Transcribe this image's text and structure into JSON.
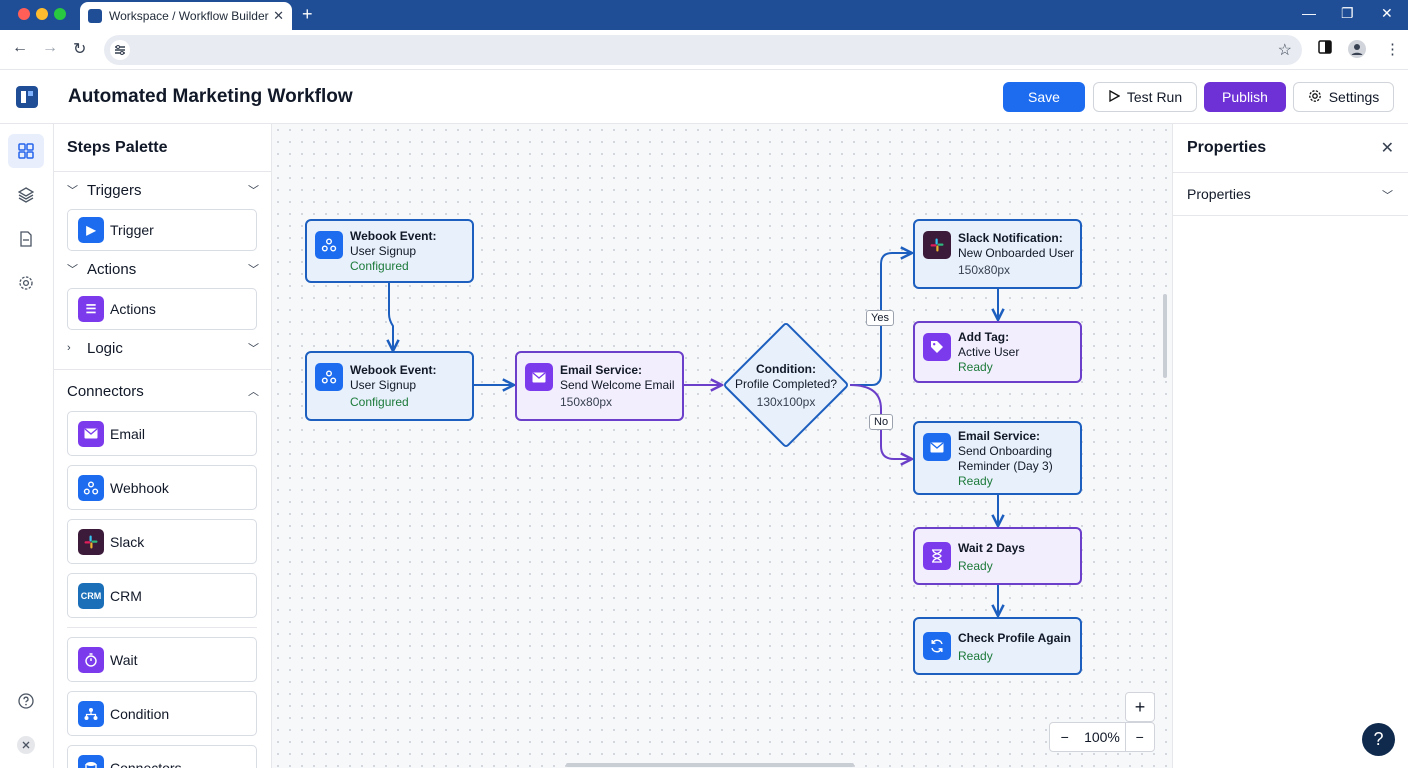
{
  "browser": {
    "tab_title": "Workspace / Workflow Builder",
    "tab_close": "✕",
    "new_tab": "+",
    "window_controls": [
      "—",
      "❐",
      "✕"
    ],
    "nav": {
      "back": "←",
      "forward": "→",
      "reload": "↻"
    },
    "site_info_icon": "tune-icon",
    "bookmark_icon": "star-icon"
  },
  "header": {
    "title": "Automated Marketing Workflow",
    "save": "Save",
    "test_run": "Test Run",
    "publish": "Publish",
    "settings": "Settings"
  },
  "palette": {
    "title": "Steps Palette",
    "sections": {
      "triggers": "Triggers",
      "actions": "Actions",
      "logic": "Logic",
      "connectors": "Connectors"
    },
    "items": {
      "trigger": "Trigger",
      "actions": "Actions",
      "email": "Email",
      "webhook": "Webhook",
      "slack": "Slack",
      "crm": "CRM",
      "crm_badge": "CRM",
      "wait": "Wait",
      "condition": "Condition",
      "connectors": "Connectors"
    }
  },
  "canvas": {
    "nodes": {
      "webhook1": {
        "title": "Webook Event:",
        "subtitle": "User Signup",
        "status": "Configured"
      },
      "webhook2": {
        "title": "Webook Event:",
        "subtitle": "User Signup",
        "status": "Configured"
      },
      "email_welcome": {
        "title": "Email Service:",
        "subtitle": "Send Welcome Email",
        "size": "150x80px"
      },
      "condition": {
        "title": "Condition:",
        "subtitle": "Profile Completed?",
        "size": "130x100px"
      },
      "slack": {
        "title": "Slack Notification:",
        "subtitle": "New Onboarded User",
        "size": "150x80px"
      },
      "add_tag": {
        "title": "Add Tag:",
        "subtitle": "Active User",
        "status": "Ready"
      },
      "email_reminder": {
        "title": "Email Service:",
        "subtitle_1": "Send Onboarding",
        "subtitle_2": "Reminder (Day 3)",
        "status": "Ready"
      },
      "wait": {
        "title": "Wait 2 Days",
        "status": "Ready"
      },
      "check": {
        "title": "Check Profile Again",
        "status": "Ready"
      }
    },
    "edge_labels": {
      "yes": "Yes",
      "no": "No"
    },
    "zoom": {
      "level": "100%",
      "in": "+",
      "out": "−",
      "out_left": "−"
    }
  },
  "properties": {
    "title": "Properties",
    "section": "Properties",
    "close": "✕"
  },
  "help": "?",
  "colors": {
    "brand": "#1f4e96",
    "primary": "#1d6cf0",
    "publish": "#6d31d6",
    "node_blue_border": "#1d5fbf",
    "node_purple_border": "#6b3fc9",
    "status_green": "#1d7a3a"
  }
}
